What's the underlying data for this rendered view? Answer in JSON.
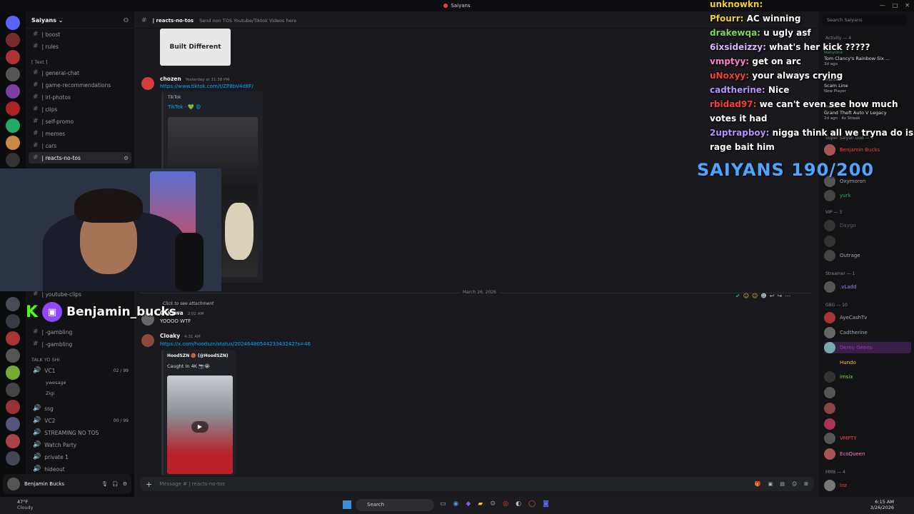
{
  "window": {
    "title": "Saiyans"
  },
  "server": {
    "name": "Saiyans ⌄"
  },
  "channel_header": {
    "name": "| reacts-no-tos",
    "topic": "Send non TOS Youtube/Tiktok Videos here"
  },
  "search": {
    "placeholder": "Search Saiyans"
  },
  "channels": [
    {
      "label": "| boost"
    },
    {
      "label": "| rules"
    },
    {
      "label": "| general-chat"
    },
    {
      "label": "| game-recommendations"
    },
    {
      "label": "| irl-photos"
    },
    {
      "label": "| clips"
    },
    {
      "label": "| self-promo"
    },
    {
      "label": "| memes"
    },
    {
      "label": "| cars"
    },
    {
      "label": "| reacts-no-tos"
    }
  ],
  "category_text": "[ Text ]",
  "lower_channels": [
    {
      "label": "| youtube-clips"
    },
    {
      "label": "| -gambling"
    },
    {
      "label": "| -gambling"
    }
  ],
  "voice_category": "TALK YO SHI",
  "voice": [
    {
      "label": "VC1",
      "count": "02 / 99"
    },
    {
      "label": "ywesage"
    },
    {
      "label": "Zigi"
    },
    {
      "label": "ssg"
    },
    {
      "label": "VC2",
      "count": "00 / 99"
    },
    {
      "label": "STREAMING NO TOS"
    },
    {
      "label": "Watch Party"
    },
    {
      "label": "private 1"
    },
    {
      "label": "hideout"
    }
  ],
  "messages": {
    "embed_label": "Built Different",
    "m1_author": "chozen",
    "m1_time": "Yesterday at 11:38 PM",
    "m1_link": "https://www.tiktok.com/t/ZP8bV4d8F/",
    "m1_embed_site": "TikTok",
    "m1_embed_title": "TikTok · 💚 😩",
    "date_divider": "March 26, 2026",
    "reply_preview": "Click to see attachment",
    "m2_author": "Ockywa",
    "m2_time": "2:02 AM",
    "m2_text": "YOOOO WTF",
    "m3_author": "Cloaky",
    "m3_time": "4:31 AM",
    "m3_link": "https://x.com/hoodszn/status/2024648054423343242?s=46",
    "m3_embed_author": "HoodSZN 🏀 (@HoodSZN)",
    "m3_embed_text": "Caught In 4K 📷😭"
  },
  "message_input": {
    "placeholder": "Message # | reacts-no-tos"
  },
  "user_panel": {
    "name": "Benjamin Bucks"
  },
  "overlay": {
    "chat": [
      {
        "user": "unknowkn:",
        "text": "",
        "color": "#f5d020"
      },
      {
        "user": "Pfourr:",
        "text": "AC winning",
        "color": "#f5d020"
      },
      {
        "user": "drakewqa:",
        "text": "u ugly asf",
        "color": "#7ed957"
      },
      {
        "user": "6ixsideizzy:",
        "text": "what's her kick ?????",
        "color": "#d8b8ff"
      },
      {
        "user": "vmptyy:",
        "text": "get on arc",
        "color": "#ff7ec7"
      },
      {
        "user": "uNoxyy:",
        "text": "your always crying",
        "color": "#ff3b3b"
      },
      {
        "user": "cadtherine:",
        "text": "Nice",
        "color": "#b693ff"
      },
      {
        "user": "rbidad97:",
        "text": "we can't even see how much",
        "color": "#ff3b3b"
      },
      {
        "user": "",
        "text": "votes it had",
        "color": "#ffffff"
      },
      {
        "user": "2uptrapboy:",
        "text": "nigga think all we tryna do is",
        "color": "#b693ff"
      },
      {
        "user": "",
        "text": "rage bait him",
        "color": "#ffffff"
      }
    ],
    "goal": "SAIYANS 190/200",
    "twitch_name": "Benjamin_bucks"
  },
  "activity": {
    "header": "Activity — 4",
    "items": [
      {
        "user": "ManyOne",
        "detail": "Tom Clancy's Rainbow Six ...",
        "sub": "3d ago"
      },
      {
        "user": "chance",
        "detail": "Scam Line",
        "sub": "New Player"
      },
      {
        "user": "chance",
        "detail": "Grand Theft Auto V Legacy",
        "sub": "2d ago · 4x Streak"
      }
    ]
  },
  "members": {
    "sections": [
      {
        "label": "Super Saiyan God — 4"
      },
      {
        "label": "VIP — 3"
      },
      {
        "label": "Streamer — 1"
      },
      {
        "label": "GBG — 10"
      },
      {
        "label": "MM8 — 4"
      }
    ],
    "list": [
      {
        "name": "Benjamin Bucks",
        "color": "#ed4245"
      },
      {
        "name": "Oxymoron",
        "color": "#8b8f96"
      },
      {
        "name": "yurk",
        "color": "#8b8f96"
      },
      {
        "name": "Daygo",
        "color": "#5c5f66"
      },
      {
        "name": "",
        "color": "#5c5f66"
      },
      {
        "name": "Outrage",
        "color": "#8b8f96"
      },
      {
        "name": ".vLadd",
        "color": "#a084f5"
      },
      {
        "name": "AyeCashTv",
        "color": "#a4a8ae"
      },
      {
        "name": "Cadtherine",
        "color": "#a4a8ae"
      },
      {
        "name": "Demu Geeeu",
        "color": "#8f3fb8"
      },
      {
        "name": "Hundo",
        "color": "#f5c542"
      },
      {
        "name": "imsix",
        "color": "#7ed957"
      },
      {
        "name": "",
        "color": "#8b8f96"
      },
      {
        "name": "",
        "color": "#8b8f96"
      },
      {
        "name": "",
        "color": "#8b8f96"
      },
      {
        "name": "VMPTY",
        "color": "#ed4245"
      },
      {
        "name": "EcoQueen",
        "color": "#ff7ec7"
      },
      {
        "name": "loz",
        "color": "#ed4245"
      }
    ]
  },
  "taskbar": {
    "weather_temp": "47°F",
    "weather_desc": "Cloudy",
    "search": "Search",
    "time": "6:15 AM",
    "date": "3/26/2026"
  },
  "colors": {
    "accent": "#5865f2",
    "link": "#00a8fc",
    "goal": "#4ea5ff"
  }
}
